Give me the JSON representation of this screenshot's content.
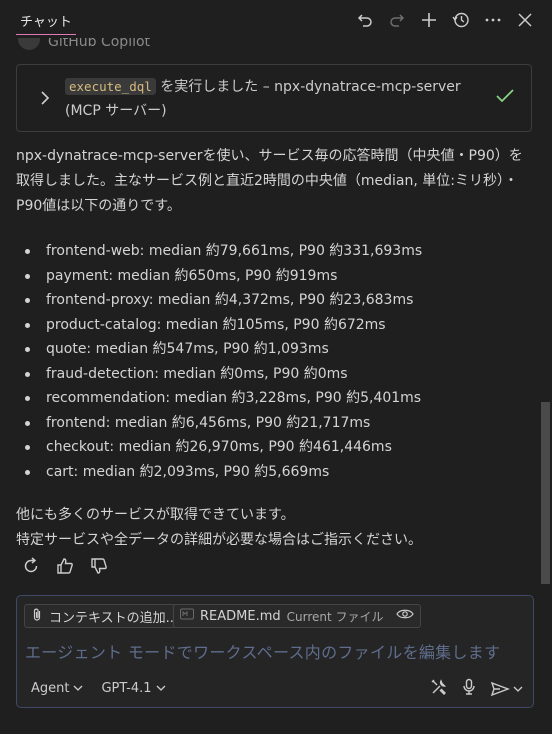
{
  "titlebar": {
    "tab": "チャット",
    "actions": [
      "undo-icon",
      "redo-icon",
      "plus-icon",
      "history-icon",
      "more-icon",
      "close-icon"
    ]
  },
  "copilot_header": "GitHub Copilot",
  "tool_call": {
    "code": "execute_dql",
    "text_line1": "を実行しました – npx-dynatrace-mcp-server",
    "text_line2": "(MCP サーバー)"
  },
  "message": {
    "intro_line1": "npx-dynatrace-mcp-serverを使い、サービス毎の応答時間（中央値・P90）を",
    "intro_line2": "取得しました。主なサービス例と直近2時間の中央値（median, 単位:ミリ秒）・",
    "intro_line3": "P90値は以下の通りです。",
    "items": [
      "frontend-web: median 約79,661ms, P90 約331,693ms",
      "payment: median 約650ms, P90 約919ms",
      "frontend-proxy: median 約4,372ms, P90 約23,683ms",
      "product-catalog: median 約105ms, P90 約672ms",
      "quote: median 約547ms, P90 約1,093ms",
      "fraud-detection: median 約0ms, P90 約0ms",
      "recommendation: median 約3,228ms, P90 約5,401ms",
      "frontend: median 約6,456ms, P90 約21,717ms",
      "checkout: median 約26,970ms, P90 約461,446ms",
      "cart: median 約2,093ms, P90 約5,669ms"
    ],
    "outro_line1": "他にも多くのサービスが取得できています。",
    "outro_line2": "特定サービスや全データの詳細が必要な場合はご指示ください。"
  },
  "input": {
    "chip_context": "コンテキストの追加...",
    "chip_file": "README.md",
    "chip_file_sub": "Current ファイル",
    "placeholder": "エージェント モードでワークスペース内のファイルを編集します",
    "mode": "Agent",
    "model": "GPT-4.1"
  },
  "colors": {
    "background": "#1f1f1f",
    "accent_tab": "#e07ab4",
    "check": "#89d185",
    "input_border": "#3e4a66"
  }
}
